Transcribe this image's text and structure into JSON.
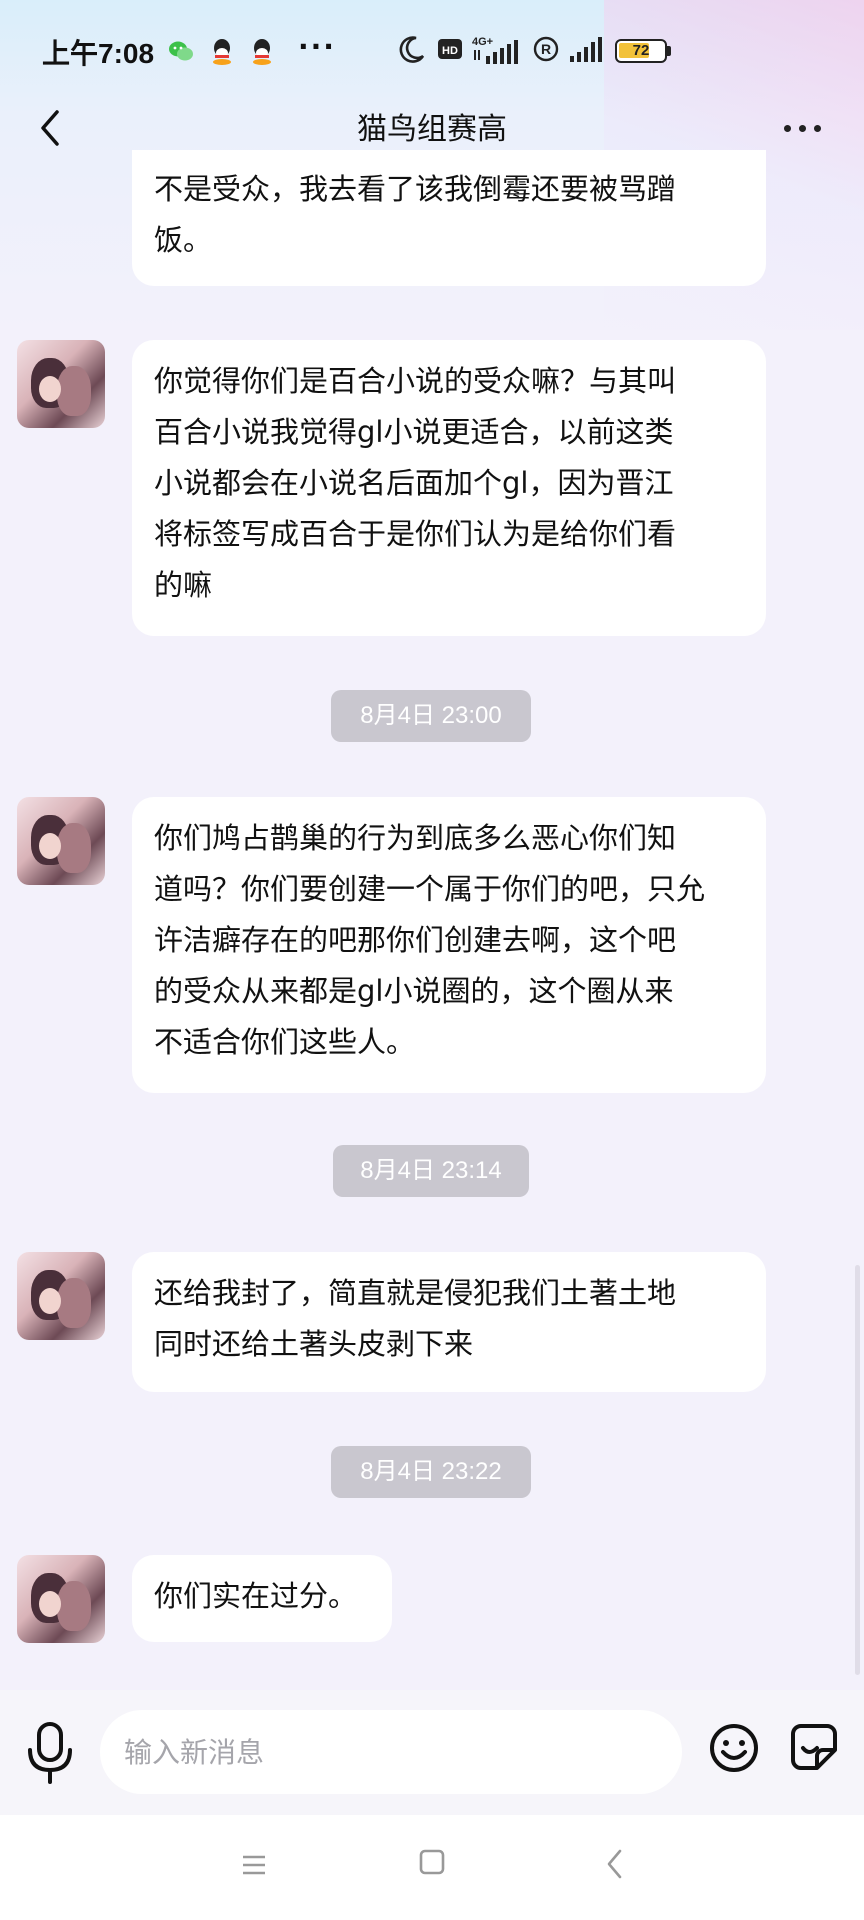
{
  "status_bar": {
    "time": "上午7:08",
    "network": "4G+",
    "battery": "72",
    "icons": [
      "wechat-icon",
      "qq-icon",
      "qq-icon",
      "more-dots",
      "moon-icon",
      "hd-icon",
      "signal-icon",
      "r-icon",
      "signal-icon",
      "battery-icon"
    ]
  },
  "header": {
    "title": "猫鸟组赛高",
    "back_icon": "chevron-left-icon",
    "more_icon": "more-horizontal-icon"
  },
  "messages": [
    {
      "type": "text",
      "text": "不是受众，我去看了该我倒霉还要被骂蹭饭。",
      "lines": [
        "不是受众，我去看了该我倒霉还要被骂蹭",
        "饭。"
      ],
      "has_avatar": false
    },
    {
      "type": "text",
      "text": "你觉得你们是百合小说的受众嘛？与其叫百合小说我觉得gl小说更适合，以前这类小说都会在小说名后面加个gl，因为晋江将标签写成百合于是你们认为是给你们看的嘛",
      "lines": [
        "你觉得你们是百合小说的受众嘛？与其叫",
        "百合小说我觉得gl小说更适合，以前这类",
        "小说都会在小说名后面加个gl，因为晋江",
        "将标签写成百合于是你们认为是给你们看",
        "的嘛"
      ],
      "has_avatar": true
    },
    {
      "type": "time",
      "text": "8月4日 23:00"
    },
    {
      "type": "text",
      "text": "你们鸠占鹊巢的行为到底多么恶心你们知道吗？你们要创建一个属于你们的吧，只允许洁癖存在的吧那你们创建去啊，这个吧的受众从来都是gl小说圈的，这个圈从来不适合你们这些人。",
      "lines": [
        "你们鸠占鹊巢的行为到底多么恶心你们知",
        "道吗？你们要创建一个属于你们的吧，只允",
        "许洁癖存在的吧那你们创建去啊，这个吧",
        "的受众从来都是gl小说圈的，这个圈从来",
        "不适合你们这些人。"
      ],
      "has_avatar": true
    },
    {
      "type": "time",
      "text": "8月4日 23:14"
    },
    {
      "type": "text",
      "text": "还给我封了，简直就是侵犯我们土著土地同时还给土著头皮剥下来",
      "lines": [
        "还给我封了，简直就是侵犯我们土著土地",
        "同时还给土著头皮剥下来"
      ],
      "has_avatar": true
    },
    {
      "type": "time",
      "text": "8月4日 23:22"
    },
    {
      "type": "text",
      "text": "你们实在过分。",
      "lines": [
        "你们实在过分。"
      ],
      "has_avatar": true
    }
  ],
  "input_bar": {
    "placeholder": "输入新消息",
    "value": "",
    "icons": [
      "microphone-icon",
      "emoji-icon",
      "sticker-icon"
    ]
  },
  "nav_bar": {
    "icons": [
      "menu-icon",
      "home-square-icon",
      "back-chevron-icon"
    ]
  }
}
